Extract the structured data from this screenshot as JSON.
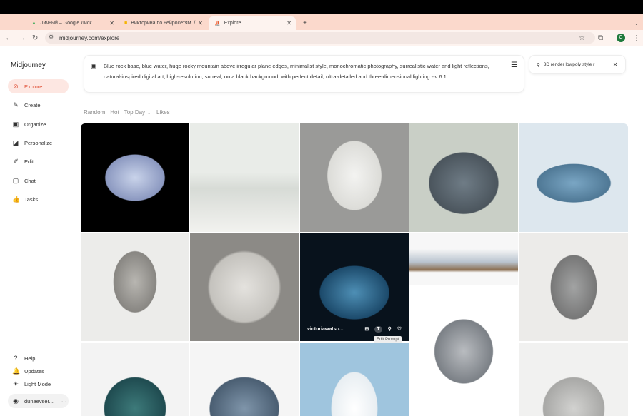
{
  "browser": {
    "tabs": [
      {
        "title": "Личный – Google Диск"
      },
      {
        "title": "Викторина по нейросетям. /"
      },
      {
        "title": "Explore",
        "active": true
      }
    ],
    "url": "midjourney.com/explore",
    "profile_initial": "C"
  },
  "sidebar": {
    "logo": "Midjourney",
    "items": [
      {
        "label": "Explore",
        "icon": "compass-icon",
        "active": true
      },
      {
        "label": "Create",
        "icon": "brush-icon"
      },
      {
        "label": "Organize",
        "icon": "image-icon"
      },
      {
        "label": "Personalize",
        "icon": "personalize-icon"
      },
      {
        "label": "Edit",
        "icon": "edit-icon"
      },
      {
        "label": "Chat",
        "icon": "chat-icon"
      },
      {
        "label": "Tasks",
        "icon": "thumbs-up-icon"
      }
    ],
    "bottom": [
      {
        "label": "Help"
      },
      {
        "label": "Updates"
      },
      {
        "label": "Light Mode"
      }
    ],
    "user": "dunaevser..."
  },
  "prompt": {
    "text": "Blue rock base, blue water, huge rocky mountain above irregular plane edges, minimalist style, monochromatic photography, surrealistic water and light reflections, natural-inspired digital art, high-resolution, surreal, on a black background, with perfect detail, ultra-detailed and three-dimensional lighting --v 6.1"
  },
  "search": {
    "value": "3D render lowpoly style r"
  },
  "filters": {
    "random": "Random",
    "hot": "Hot",
    "top_day": "Top Day",
    "likes": "Likes"
  },
  "hover": {
    "user": "victoriawatso...",
    "tooltip": "Edit Prompt"
  },
  "accent": "#e2553c"
}
